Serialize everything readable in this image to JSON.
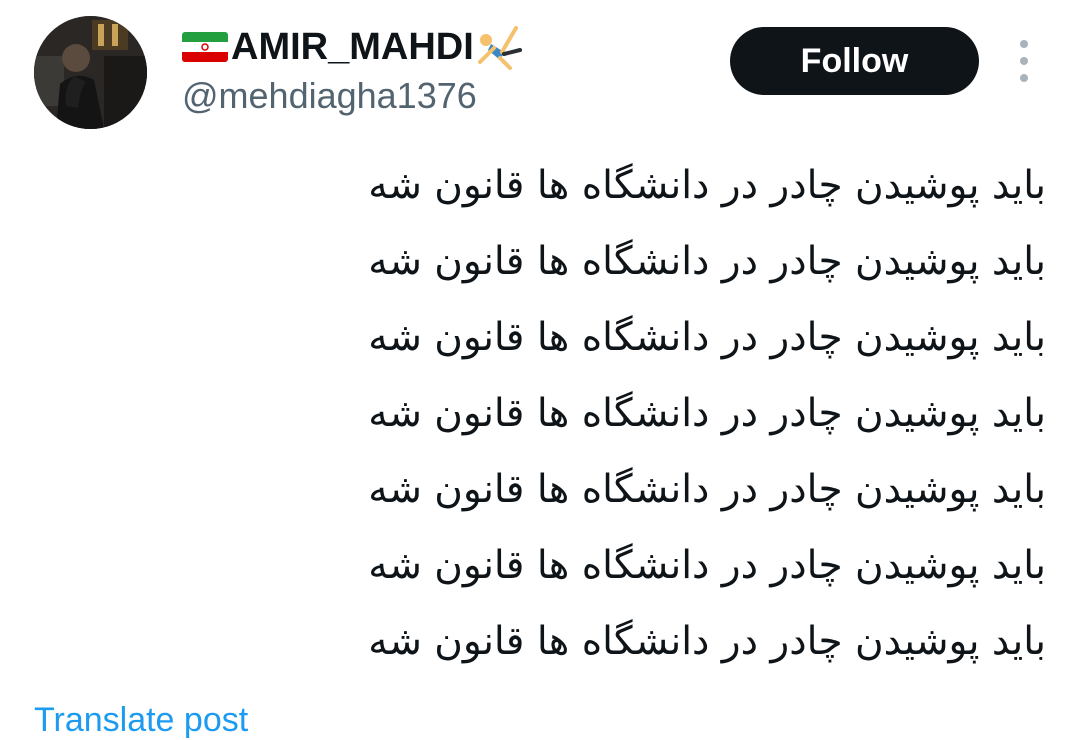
{
  "author": {
    "display_name": "AMIR_MAHDI",
    "handle": "@mehdiagha1376",
    "name_emoji_prefix": "iran-flag-icon",
    "name_emoji_suffix": "person-cartwheeling-icon"
  },
  "actions": {
    "follow_label": "Follow",
    "more_icon": "more-vertical-icon"
  },
  "tweet": {
    "lines": [
      "باید پوشیدن چادر در دانشگاه ها قانون شه",
      "باید پوشیدن چادر در دانشگاه ها قانون شه",
      "باید پوشیدن چادر در دانشگاه ها قانون شه",
      "باید پوشیدن چادر در دانشگاه ها قانون شه",
      "باید پوشیدن چادر در دانشگاه ها قانون شه",
      "باید پوشیدن چادر در دانشگاه ها قانون شه",
      "باید پوشیدن چادر در دانشگاه ها قانون شه"
    ],
    "translate_label": "Translate post"
  },
  "colors": {
    "text_primary": "#0f1419",
    "text_secondary": "#536471",
    "follow_bg": "#0f1419",
    "follow_text": "#ffffff",
    "link": "#1d9bf0",
    "more_dots": "#a8b3bb"
  }
}
